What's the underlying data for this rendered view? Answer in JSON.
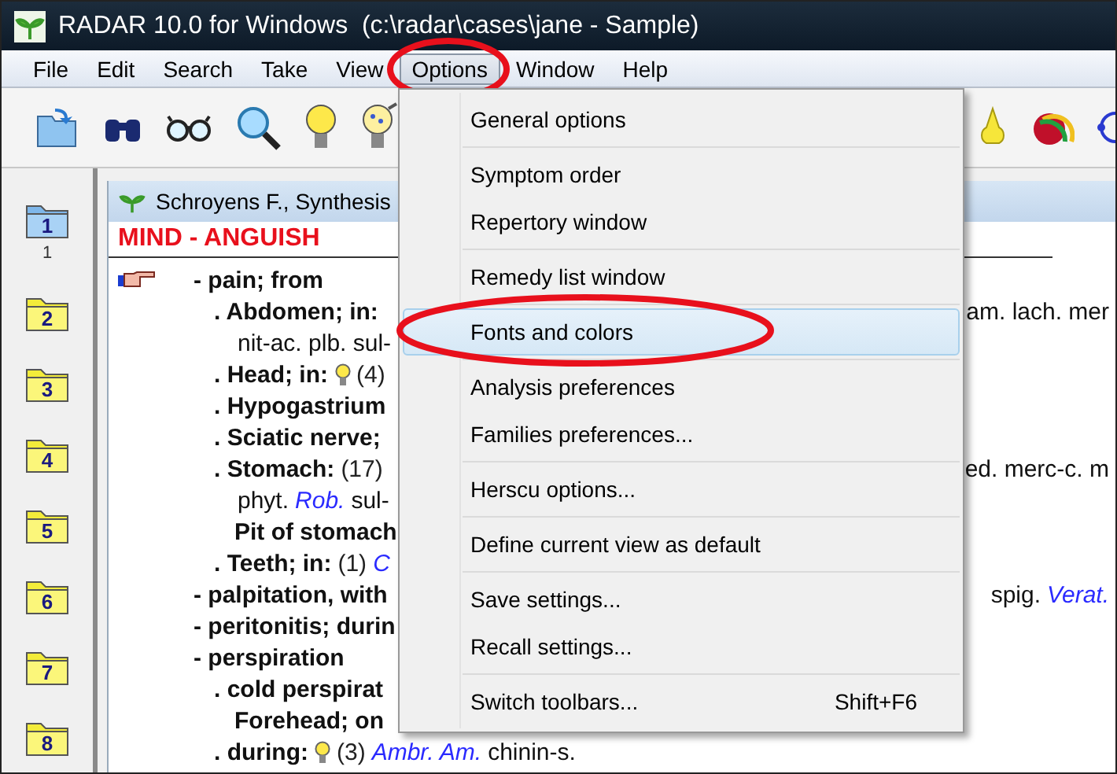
{
  "window": {
    "title": "RADAR 10.0 for Windows  (c:\\radar\\cases\\jane - Sample)"
  },
  "menu_bar": [
    {
      "label": "File",
      "selected": false,
      "circled": false
    },
    {
      "label": "Edit",
      "selected": false,
      "circled": false
    },
    {
      "label": "Search",
      "selected": false,
      "circled": false
    },
    {
      "label": "Take",
      "selected": false,
      "circled": false
    },
    {
      "label": "View",
      "selected": false,
      "circled": false
    },
    {
      "label": "Options",
      "selected": true,
      "circled": true
    },
    {
      "label": "Window",
      "selected": false,
      "circled": false
    },
    {
      "label": "Help",
      "selected": false,
      "circled": false
    }
  ],
  "sidebar": {
    "folders": [
      {
        "label": "1",
        "selected": true,
        "caption": "1"
      },
      {
        "label": "2",
        "selected": false
      },
      {
        "label": "3",
        "selected": false
      },
      {
        "label": "4",
        "selected": false
      },
      {
        "label": "5",
        "selected": false
      },
      {
        "label": "6",
        "selected": false
      },
      {
        "label": "7",
        "selected": false
      },
      {
        "label": "8",
        "selected": false
      }
    ]
  },
  "document": {
    "title": "Schroyens F., Synthesis",
    "heading": "MIND - ANGUISH",
    "entries": [
      {
        "pointer": true,
        "segments": [
          {
            "kind": "rubric",
            "text": "- pain; from"
          }
        ],
        "children": [
          {
            "segments": [
              {
                "kind": "rubric",
                "text": ". Abdomen; in:"
              }
            ],
            "right": [
              {
                "kind": "remedy",
                "text": "am. lach. mer"
              }
            ],
            "continuation": [
              [
                {
                  "kind": "remedy",
                  "text": "nit-ac. plb. sul-"
                }
              ]
            ]
          },
          {
            "segments": [
              {
                "kind": "rubric",
                "text": ". Head; in:"
              },
              {
                "kind": "marker"
              },
              {
                "kind": "count",
                "text": "(4)"
              }
            ]
          },
          {
            "segments": [
              {
                "kind": "rubric",
                "text": ". Hypogastrium"
              }
            ]
          },
          {
            "segments": [
              {
                "kind": "rubric",
                "text": ". Sciatic nerve;"
              }
            ]
          },
          {
            "segments": [
              {
                "kind": "rubric",
                "text": ". Stomach:"
              },
              {
                "kind": "count",
                "text": "(17)"
              }
            ],
            "right": [
              {
                "kind": "remedy",
                "text": "ed. merc-c. m"
              }
            ],
            "continuation": [
              [
                {
                  "kind": "remedy",
                  "text": "phyt."
                },
                {
                  "kind": "remedy_strong",
                  "text": "Rob."
                },
                {
                  "kind": "remedy",
                  "text": "sul-"
                }
              ]
            ],
            "children": [
              {
                "segments": [
                  {
                    "kind": "rubric",
                    "text": "Pit of stomach"
                  }
                ]
              }
            ]
          },
          {
            "segments": [
              {
                "kind": "rubric",
                "text": ". Teeth; in:"
              },
              {
                "kind": "count",
                "text": "(1)"
              },
              {
                "kind": "remedy_strong",
                "text": "C"
              }
            ]
          }
        ]
      },
      {
        "segments": [
          {
            "kind": "rubric",
            "text": "- palpitation, with"
          }
        ],
        "right": [
          {
            "kind": "remedy",
            "text": "spig."
          },
          {
            "kind": "remedy_strong",
            "text": "Verat."
          }
        ]
      },
      {
        "segments": [
          {
            "kind": "rubric",
            "text": "- peritonitis; durin"
          }
        ]
      },
      {
        "segments": [
          {
            "kind": "rubric",
            "text": "- perspiration"
          }
        ],
        "children": [
          {
            "segments": [
              {
                "kind": "rubric",
                "text": ". cold perspirat"
              }
            ],
            "children": [
              {
                "segments": [
                  {
                    "kind": "rubric",
                    "text": "Forehead; on"
                  }
                ]
              }
            ]
          },
          {
            "segments": [
              {
                "kind": "rubric",
                "text": ". during:"
              },
              {
                "kind": "marker"
              },
              {
                "kind": "count",
                "text": "(3)"
              },
              {
                "kind": "remedy_strong",
                "text": "Ambr. Am."
              },
              {
                "kind": "remedy",
                "text": "chinin-s."
              }
            ]
          }
        ]
      }
    ]
  },
  "options_menu": {
    "groups": [
      [
        {
          "label": "General options",
          "selected": false,
          "circled": false
        }
      ],
      [
        {
          "label": "Symptom order",
          "selected": false,
          "circled": false
        },
        {
          "label": "Repertory window",
          "selected": false,
          "circled": false
        }
      ],
      [
        {
          "label": "Remedy list window",
          "selected": false,
          "circled": false
        }
      ],
      [
        {
          "label": "Fonts and colors",
          "selected": true,
          "circled": true
        }
      ],
      [
        {
          "label": "Analysis preferences",
          "selected": false,
          "circled": false
        },
        {
          "label": "Families preferences...",
          "selected": false,
          "circled": false
        }
      ],
      [
        {
          "label": "Herscu options...",
          "selected": false,
          "circled": false
        }
      ],
      [
        {
          "label": "Define current view as default",
          "selected": false,
          "circled": false
        }
      ],
      [
        {
          "label": "Save settings...",
          "selected": false,
          "circled": false
        },
        {
          "label": "Recall settings...",
          "selected": false,
          "circled": false
        }
      ],
      [
        {
          "label": "Switch toolbars...",
          "shortcut": "Shift+F6",
          "selected": false,
          "circled": false
        }
      ]
    ]
  }
}
